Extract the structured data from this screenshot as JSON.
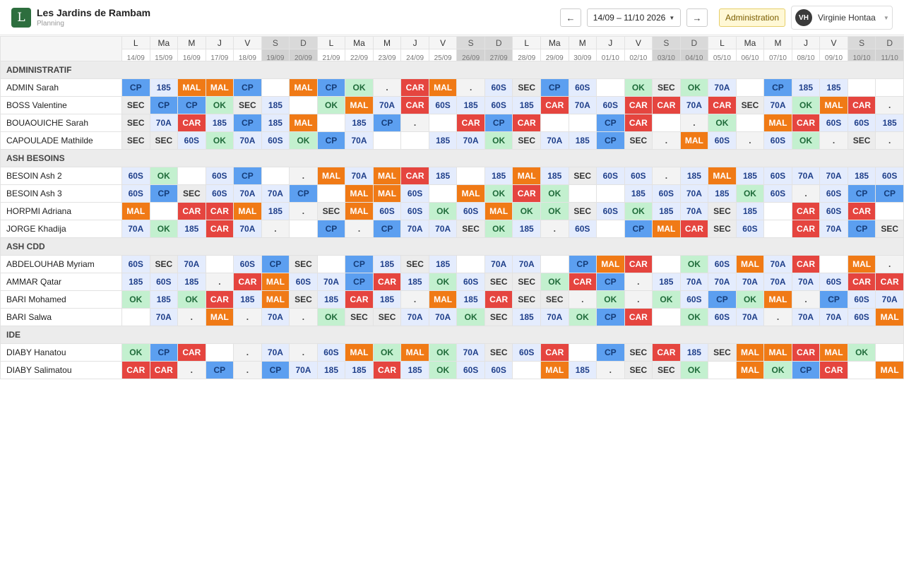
{
  "header": {
    "logo_letter": "L",
    "app_title": "Les Jardins de Rambam",
    "app_subtitle": "Planning",
    "prev_label": "←",
    "next_label": "→",
    "date_range": "14/09 – 11/10 2026",
    "admin_label": "Administration",
    "user_initials": "VH",
    "user_name": "Virginie Hontaa"
  },
  "days": [
    {
      "d": "L",
      "date": "14/09",
      "we": false
    },
    {
      "d": "Ma",
      "date": "15/09",
      "we": false
    },
    {
      "d": "M",
      "date": "16/09",
      "we": false
    },
    {
      "d": "J",
      "date": "17/09",
      "we": false
    },
    {
      "d": "V",
      "date": "18/09",
      "we": false
    },
    {
      "d": "S",
      "date": "19/09",
      "we": true
    },
    {
      "d": "D",
      "date": "20/09",
      "we": true
    },
    {
      "d": "L",
      "date": "21/09",
      "we": false
    },
    {
      "d": "Ma",
      "date": "22/09",
      "we": false
    },
    {
      "d": "M",
      "date": "23/09",
      "we": false
    },
    {
      "d": "J",
      "date": "24/09",
      "we": false
    },
    {
      "d": "V",
      "date": "25/09",
      "we": false
    },
    {
      "d": "S",
      "date": "26/09",
      "we": true
    },
    {
      "d": "D",
      "date": "27/09",
      "we": true
    },
    {
      "d": "L",
      "date": "28/09",
      "we": false
    },
    {
      "d": "Ma",
      "date": "29/09",
      "we": false
    },
    {
      "d": "M",
      "date": "30/09",
      "we": false
    },
    {
      "d": "J",
      "date": "01/10",
      "we": false
    },
    {
      "d": "V",
      "date": "02/10",
      "we": false
    },
    {
      "d": "S",
      "date": "03/10",
      "we": true
    },
    {
      "d": "D",
      "date": "04/10",
      "we": true
    },
    {
      "d": "L",
      "date": "05/10",
      "we": false
    },
    {
      "d": "Ma",
      "date": "06/10",
      "we": false
    },
    {
      "d": "M",
      "date": "07/10",
      "we": false
    },
    {
      "d": "J",
      "date": "08/10",
      "we": false
    },
    {
      "d": "V",
      "date": "09/10",
      "we": false
    },
    {
      "d": "S",
      "date": "10/10",
      "we": true
    },
    {
      "d": "D",
      "date": "11/10",
      "we": true
    }
  ],
  "sections": [
    {
      "title": "ADMINISTRATIF",
      "people": [
        {
          "name": "ADMIN Sarah",
          "cells": [
            "CP",
            "185",
            "MAL",
            "MAL",
            "CP",
            "",
            "MAL",
            "CP",
            "OK",
            ".",
            "CAR",
            "MAL",
            ".",
            "60S",
            "SEC",
            "CP",
            "60S",
            "",
            "OK",
            "SEC",
            "OK",
            "70A",
            "",
            "CP",
            "185",
            "185",
            "",
            ""
          ]
        },
        {
          "name": "BOSS Valentine",
          "cells": [
            "SEC",
            "CP",
            "CP",
            "OK",
            "SEC",
            "185",
            "",
            "OK",
            "MAL",
            "70A",
            "CAR",
            "60S",
            "185",
            "60S",
            "185",
            "CAR",
            "70A",
            "60S",
            "CAR",
            "CAR",
            "70A",
            "CAR",
            "SEC",
            "70A",
            "OK",
            "MAL",
            "CAR",
            "."
          ]
        },
        {
          "name": "BOUAOUICHE Sarah",
          "cells": [
            "SEC",
            "70A",
            "CAR",
            "185",
            "CP",
            "185",
            "MAL",
            "",
            "185",
            "CP",
            ".",
            "",
            "CAR",
            "CP",
            "CAR",
            "",
            "",
            "CP",
            "CAR",
            "",
            ".",
            "OK",
            "",
            "MAL",
            "CAR",
            "60S",
            "60S",
            "185"
          ]
        },
        {
          "name": "CAPOULADE Mathilde",
          "cells": [
            "SEC",
            "SEC",
            "60S",
            "OK",
            "70A",
            "60S",
            "OK",
            "CP",
            "70A",
            "",
            "",
            "185",
            "70A",
            "OK",
            "SEC",
            "70A",
            "185",
            "CP",
            "SEC",
            ".",
            "MAL",
            "60S",
            ".",
            "60S",
            "OK",
            ".",
            "SEC",
            "."
          ]
        }
      ]
    },
    {
      "title": "ASH BESOINS",
      "people": [
        {
          "name": "BESOIN Ash 2",
          "cells": [
            "60S",
            "OK",
            "",
            "60S",
            "CP",
            "",
            ".",
            "MAL",
            "70A",
            "MAL",
            "CAR",
            "185",
            "",
            "185",
            "MAL",
            "185",
            "SEC",
            "60S",
            "60S",
            ".",
            "185",
            "MAL",
            "185",
            "60S",
            "70A",
            "70A",
            "185",
            "60S"
          ]
        },
        {
          "name": "BESOIN Ash 3",
          "cells": [
            "60S",
            "CP",
            "SEC",
            "60S",
            "70A",
            "70A",
            "CP",
            "",
            "MAL",
            "MAL",
            "60S",
            "",
            "MAL",
            "OK",
            "CAR",
            "OK",
            "",
            "",
            "185",
            "60S",
            "70A",
            "185",
            "OK",
            "60S",
            ".",
            "60S",
            "CP",
            "CP"
          ]
        },
        {
          "name": "HORPMI Adriana",
          "cells": [
            "MAL",
            "",
            "CAR",
            "CAR",
            "MAL",
            "185",
            ".",
            "SEC",
            "MAL",
            "60S",
            "60S",
            "OK",
            "60S",
            "MAL",
            "OK",
            "OK",
            "SEC",
            "60S",
            "OK",
            "185",
            "70A",
            "SEC",
            "185",
            "",
            "CAR",
            "60S",
            "CAR",
            ""
          ]
        },
        {
          "name": "JORGE Khadija",
          "cells": [
            "70A",
            "OK",
            "185",
            "CAR",
            "70A",
            ".",
            "",
            "CP",
            ".",
            "CP",
            "70A",
            "70A",
            "SEC",
            "OK",
            "185",
            ".",
            "60S",
            "",
            "CP",
            "MAL",
            "CAR",
            "SEC",
            "60S",
            "",
            "CAR",
            "70A",
            "CP",
            "SEC"
          ]
        }
      ]
    },
    {
      "title": "ASH CDD",
      "people": [
        {
          "name": "ABDELOUHAB Myriam",
          "cells": [
            "60S",
            "SEC",
            "70A",
            "",
            "60S",
            "CP",
            "SEC",
            "",
            "CP",
            "185",
            "SEC",
            "185",
            "",
            "70A",
            "70A",
            "",
            "CP",
            "MAL",
            "CAR",
            "",
            "OK",
            "60S",
            "MAL",
            "70A",
            "CAR",
            "",
            "MAL",
            "."
          ]
        },
        {
          "name": "AMMAR Qatar",
          "cells": [
            "185",
            "60S",
            "185",
            ".",
            "CAR",
            "MAL",
            "60S",
            "70A",
            "CP",
            "CAR",
            "185",
            "OK",
            "60S",
            "SEC",
            "SEC",
            "OK",
            "CAR",
            "CP",
            ".",
            "185",
            "70A",
            "70A",
            "70A",
            "70A",
            "70A",
            "60S",
            "CAR",
            "CAR"
          ]
        },
        {
          "name": "BARI Mohamed",
          "cells": [
            "OK",
            "185",
            "OK",
            "CAR",
            "185",
            "MAL",
            "SEC",
            "185",
            "CAR",
            "185",
            ".",
            "MAL",
            "185",
            "CAR",
            "SEC",
            "SEC",
            ".",
            "OK",
            ".",
            "OK",
            "60S",
            "CP",
            "OK",
            "MAL",
            ".",
            "CP",
            "60S",
            "70A"
          ]
        },
        {
          "name": "BARI Salwa",
          "cells": [
            "",
            "70A",
            ".",
            "MAL",
            ".",
            "70A",
            ".",
            "OK",
            "SEC",
            "SEC",
            "70A",
            "70A",
            "OK",
            "SEC",
            "185",
            "70A",
            "OK",
            "CP",
            "CAR",
            "",
            "OK",
            "60S",
            "70A",
            ".",
            "70A",
            "70A",
            "60S",
            "MAL"
          ]
        }
      ]
    },
    {
      "title": "IDE",
      "people": [
        {
          "name": "DIABY Hanatou",
          "cells": [
            "OK",
            "CP",
            "CAR",
            "",
            ".",
            "70A",
            ".",
            "60S",
            "MAL",
            "OK",
            "MAL",
            "OK",
            "70A",
            "SEC",
            "60S",
            "CAR",
            "",
            "CP",
            "SEC",
            "CAR",
            "185",
            "SEC",
            "MAL",
            "MAL",
            "CAR",
            "MAL",
            "OK",
            ""
          ]
        },
        {
          "name": "DIABY Salimatou",
          "cells": [
            "CAR",
            "CAR",
            ".",
            "CP",
            ".",
            "CP",
            "70A",
            "185",
            "185",
            "CAR",
            "185",
            "OK",
            "60S",
            "60S",
            "",
            "MAL",
            "185",
            ".",
            "SEC",
            "SEC",
            "OK",
            "",
            "MAL",
            "OK",
            "CP",
            "CAR",
            "",
            "MAL"
          ]
        }
      ]
    }
  ]
}
